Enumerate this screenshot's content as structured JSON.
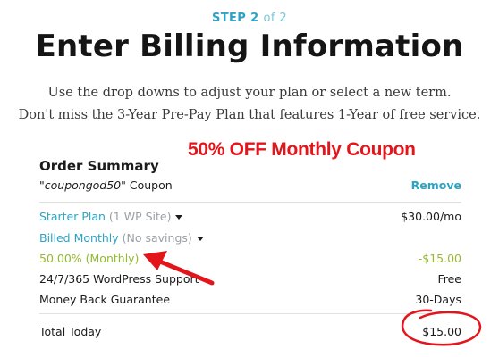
{
  "step": {
    "word": "STEP",
    "number": "2",
    "of_text": "of 2"
  },
  "title": "Enter Billing Information",
  "subtitle": {
    "line1": "Use the drop downs to adjust your plan or select a new term.",
    "line2": "Don't miss the 3-Year Pre-Pay Plan that features 1-Year of free service."
  },
  "annotation": {
    "coupon_banner": "50% OFF Monthly Coupon"
  },
  "order_summary": {
    "title": "Order Summary",
    "coupon": {
      "code": "\"coupongod50\"",
      "label": "Coupon",
      "remove_label": "Remove"
    },
    "plan": {
      "name": "Starter Plan",
      "detail": "(1 WP Site)",
      "price": "$30.00/mo"
    },
    "billing": {
      "name": "Billed Monthly",
      "detail": "(No savings)"
    },
    "discount": {
      "label": "50.00% (Monthly)",
      "amount": "-$15.00"
    },
    "support": {
      "label": "24/7/365 WordPress Support",
      "value": "Free"
    },
    "guarantee": {
      "label": "Money Back Guarantee",
      "value": "30-Days"
    },
    "total": {
      "label": "Total Today",
      "amount": "$15.00"
    }
  },
  "colors": {
    "accent": "#2ba3c4",
    "discount_green": "#93ba2c",
    "annotation_red": "#e4141b"
  }
}
